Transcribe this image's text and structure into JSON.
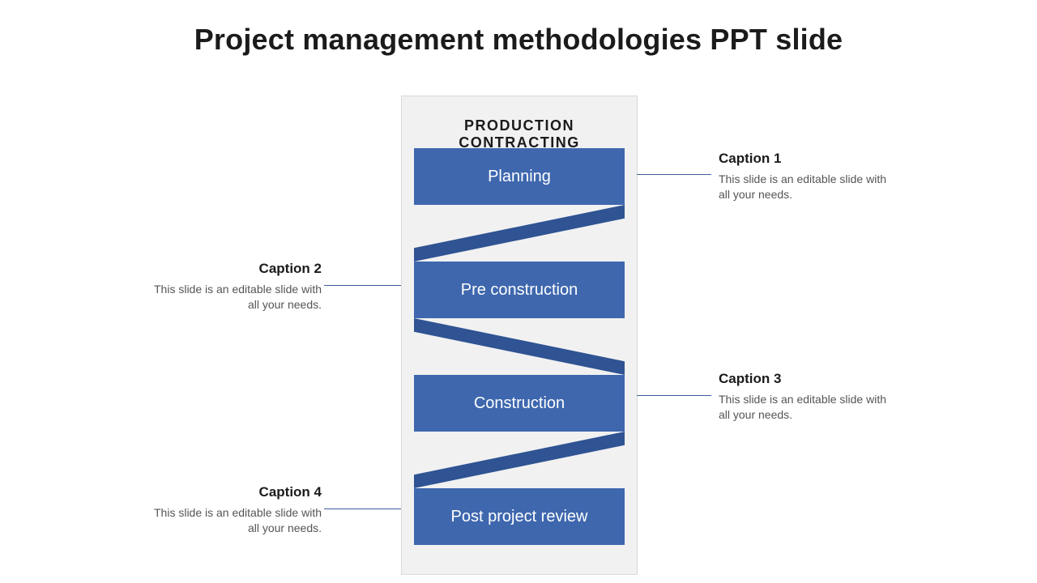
{
  "title": "Project management methodologies PPT slide",
  "panel": {
    "title": "PRODUCTION CONTRACTING",
    "steps": [
      "Planning",
      "Pre construction",
      "Construction",
      "Post project review"
    ]
  },
  "captions": [
    {
      "title": "Caption 1",
      "body": "This slide is an editable slide with all your needs."
    },
    {
      "title": "Caption 2",
      "body": "This slide is an editable slide with all your needs."
    },
    {
      "title": "Caption 3",
      "body": "This slide is an editable slide with all your needs."
    },
    {
      "title": "Caption 4",
      "body": "This slide is an editable slide with all your needs."
    }
  ]
}
